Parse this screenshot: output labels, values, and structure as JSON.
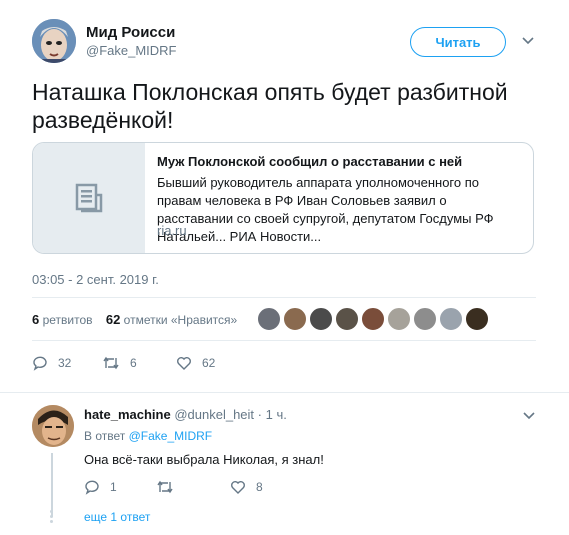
{
  "tweet": {
    "author_name": "Мид Роисси",
    "author_handle": "@Fake_MIDRF",
    "follow_label": "Читать",
    "text": "Наташка Поклонская опять будет разбитной разведёнкой!",
    "card": {
      "title": "Муж Поклонской сообщил о расставании с ней",
      "description": "Бывший руководитель аппарата уполномоченного по правам человека в РФ Иван Соловьев заявил о расставании со своей супругой, депутатом Госдумы РФ Натальей... РИА Новости...",
      "domain": "ria.ru"
    },
    "timestamp": "03:05 - 2 сент. 2019 г.",
    "stats": {
      "retweets_count": "6",
      "retweets_label": "ретвитов",
      "likes_count": "62",
      "likes_label": "отметки «Нравится»"
    },
    "actions": {
      "replies": "32",
      "retweets": "6",
      "likes": "62"
    }
  },
  "reply": {
    "name": "hate_machine",
    "handle": "@dunkel_heit",
    "time": "· 1 ч.",
    "reply_to_label": "В ответ",
    "reply_to_handle": "@Fake_MIDRF",
    "text": "Она всё-таки выбрала Николая, я знал!",
    "actions": {
      "replies": "1",
      "retweets": "",
      "likes": "8"
    },
    "more_replies": "еще 1 ответ"
  },
  "colors": {
    "accent": "#1da1f2",
    "secondary_text": "#657786",
    "border": "#e6ecf0",
    "liker_avatars": [
      "#6b6f78",
      "#8a6a4f",
      "#4b4b4b",
      "#5a5248",
      "#7a4d3a",
      "#a6a29a",
      "#8d8d8d",
      "#9aa3ad",
      "#3a2e20"
    ]
  }
}
